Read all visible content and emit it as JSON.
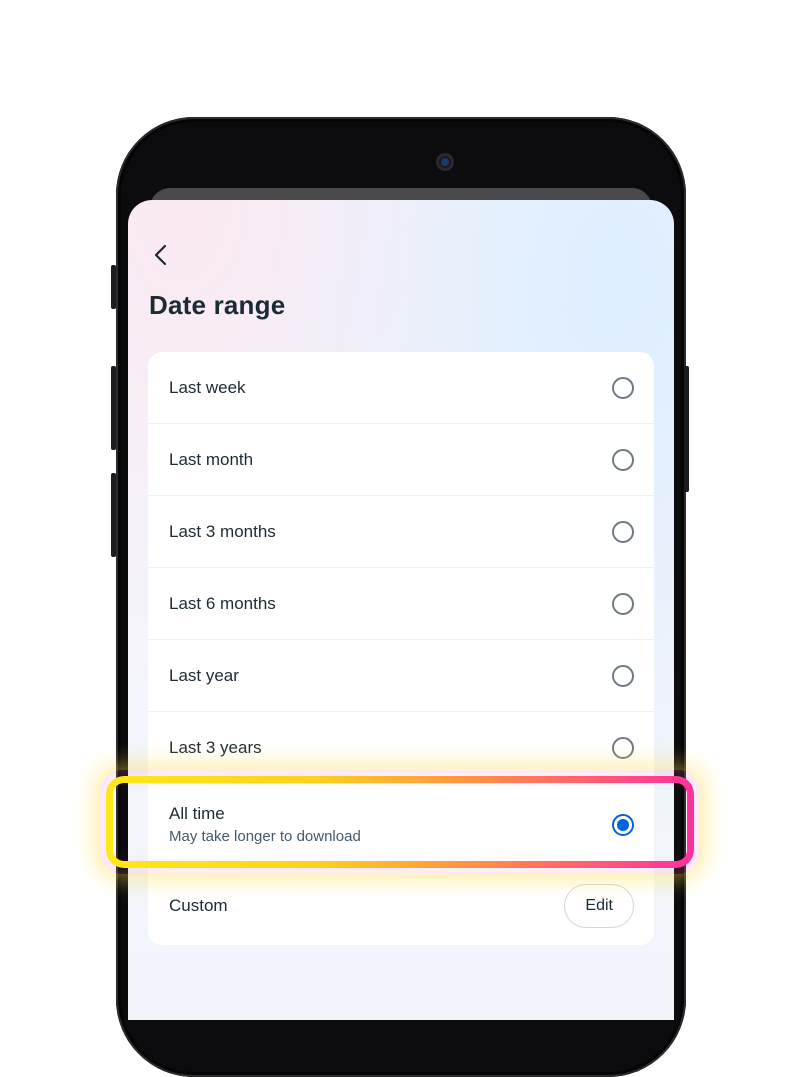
{
  "screen": {
    "title": "Date range",
    "options": [
      {
        "label": "Last week",
        "selected": false
      },
      {
        "label": "Last month",
        "selected": false
      },
      {
        "label": "Last 3 months",
        "selected": false
      },
      {
        "label": "Last 6 months",
        "selected": false
      },
      {
        "label": "Last year",
        "selected": false
      },
      {
        "label": "Last 3 years",
        "selected": false
      },
      {
        "label": "All time",
        "sublabel": "May take longer to download",
        "selected": true
      }
    ],
    "custom": {
      "label": "Custom",
      "button_label": "Edit"
    }
  },
  "icons": {
    "back": "chevron-left-icon",
    "radio": "radio-button-icon"
  },
  "colors": {
    "accent": "#0064e0",
    "highlight_start": "#ffe81a",
    "highlight_end": "#ff2fa0"
  }
}
